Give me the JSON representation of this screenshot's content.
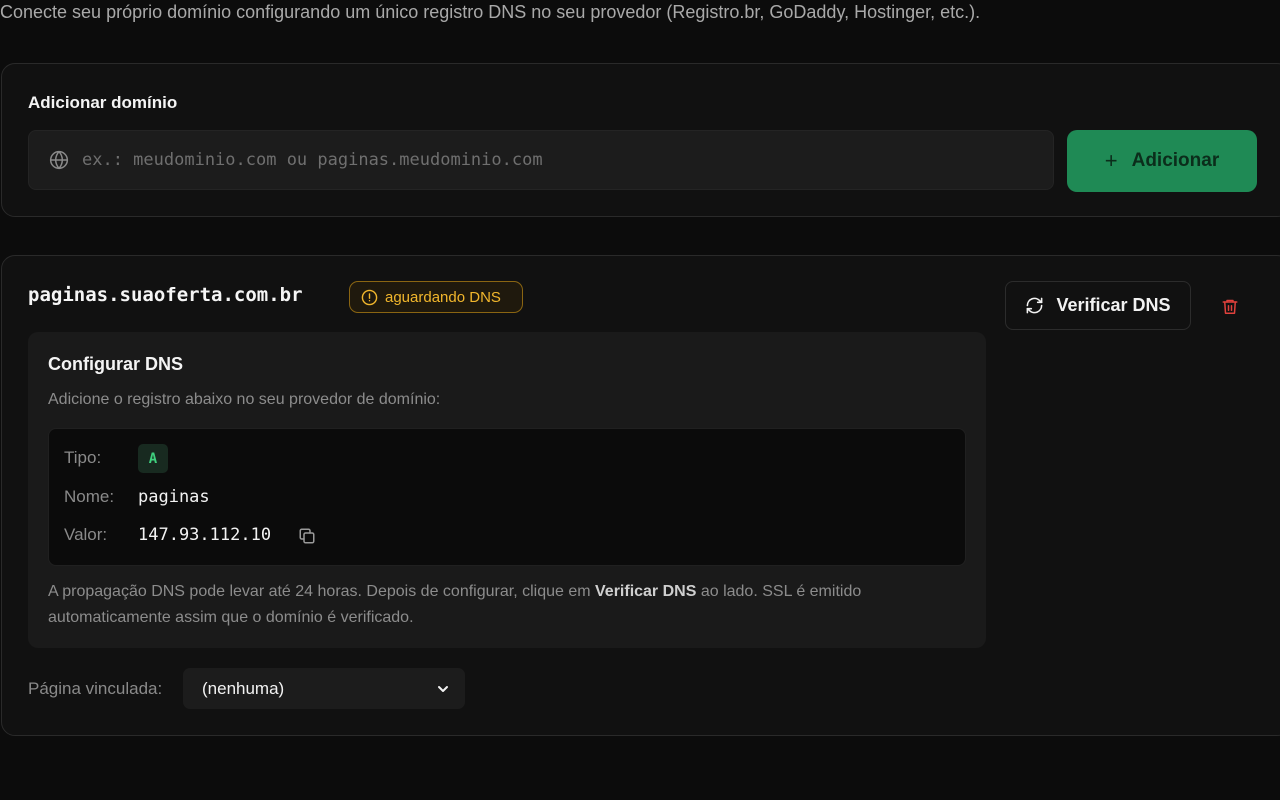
{
  "intro_text": "Conecte seu próprio domínio configurando um único registro DNS no seu provedor (Registro.br, GoDaddy, Hostinger, etc.).",
  "add_domain": {
    "title": "Adicionar domínio",
    "input_placeholder": "ex.: meudominio.com ou paginas.meudominio.com",
    "input_value": "",
    "add_button_label": "Adicionar",
    "icons": {
      "input": "globe-icon",
      "button": "plus-icon"
    }
  },
  "domain": {
    "name": "paginas.suaoferta.com.br",
    "status": "aguardando DNS",
    "verify_button_label": "Verificar DNS",
    "icons": {
      "status": "alert-circle-icon",
      "verify": "refresh-icon",
      "delete": "trash-icon"
    },
    "dns_config": {
      "title": "Configurar DNS",
      "subtitle": "Adicione o registro abaixo no seu provedor de domínio:",
      "record": {
        "type_label": "Tipo:",
        "type_value": "A",
        "name_label": "Nome:",
        "name_value": "paginas",
        "value_label": "Valor:",
        "value_value": "147.93.112.10"
      },
      "note_before": "A propagação DNS pode levar até 24 horas. Depois de configurar, clique em ",
      "note_bold": "Verificar DNS",
      "note_after": " ao lado. SSL é emitido automaticamente assim que o domínio é verificado."
    },
    "linked_page_label": "Página vinculada:",
    "linked_page_value": "(nenhuma)"
  },
  "colors": {
    "background": "#0c0c0c",
    "card": "#111111",
    "accent_green": "#1f8a55",
    "status_amber": "#f1b62c",
    "danger_red": "#e0413c"
  }
}
